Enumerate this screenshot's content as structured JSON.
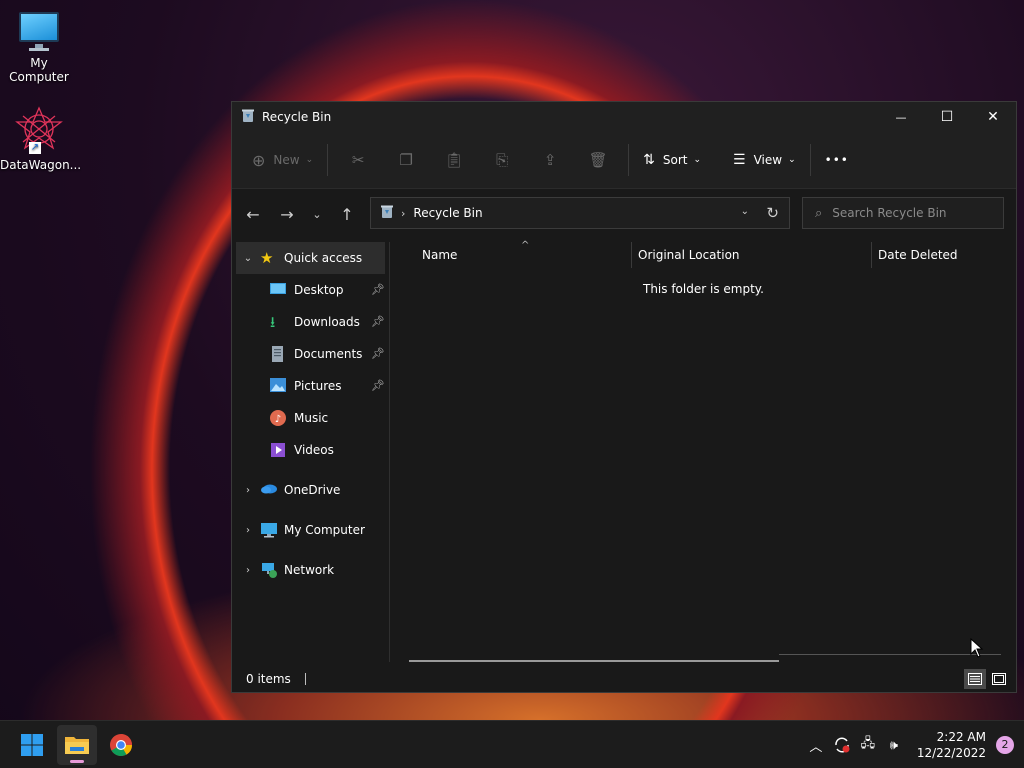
{
  "desktop": {
    "icons": [
      {
        "label": "My Computer"
      },
      {
        "label": "DataWagon..."
      }
    ]
  },
  "window": {
    "title": "Recycle Bin",
    "controls": {
      "minimize": "—",
      "maximize": "☐",
      "close": "✕"
    },
    "commandbar": {
      "new_label": "New",
      "sort_label": "Sort",
      "view_label": "View",
      "more_label": "•••",
      "icons": [
        "cut-icon",
        "copy-icon",
        "paste-icon",
        "rename-icon",
        "share-icon",
        "delete-icon"
      ]
    },
    "address": {
      "crumb": "Recycle Bin"
    },
    "search": {
      "placeholder": "Search Recycle Bin"
    },
    "navpane": {
      "quick_access": "Quick access",
      "pinned": [
        {
          "label": "Desktop",
          "pinned": true
        },
        {
          "label": "Downloads",
          "pinned": true
        },
        {
          "label": "Documents",
          "pinned": true
        },
        {
          "label": "Pictures",
          "pinned": true
        },
        {
          "label": "Music",
          "pinned": false
        },
        {
          "label": "Videos",
          "pinned": false
        }
      ],
      "onedrive": "OneDrive",
      "my_computer": "My Computer",
      "network": "Network"
    },
    "content": {
      "columns": [
        "Name",
        "Original Location",
        "Date Deleted"
      ],
      "empty_message": "This folder is empty."
    },
    "status": {
      "items": "0 items"
    }
  },
  "taskbar": {
    "clock_time": "2:22 AM",
    "clock_date": "12/22/2022",
    "notification_count": "2"
  },
  "colors": {
    "accent": "#0078d4",
    "window_bg": "#191919",
    "taskbar_bg": "#1c1c1c",
    "quick_access_star": "#f2c811"
  }
}
